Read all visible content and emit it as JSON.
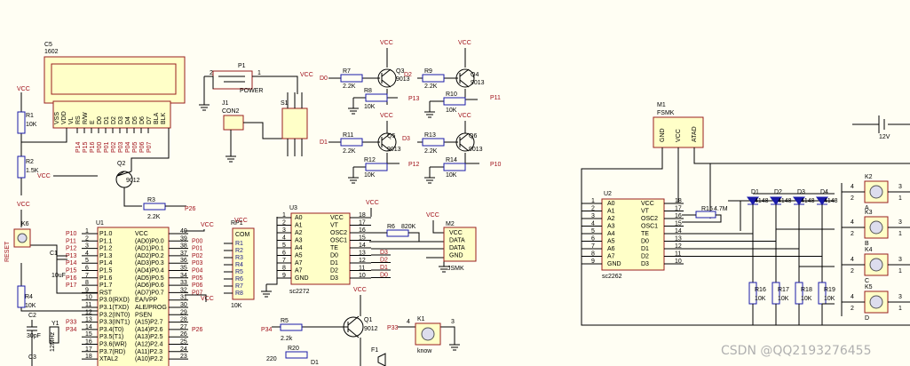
{
  "lcd": {
    "ref": "C5",
    "value": "1602",
    "pins": [
      "VSS",
      "VDD",
      "VL",
      "RS",
      "R/W",
      "E",
      "D0",
      "D1",
      "D2",
      "D3",
      "D4",
      "D5",
      "D6",
      "D7",
      "BLA",
      "BLK"
    ],
    "nets": [
      "P14",
      "P15",
      "P16",
      "P00",
      "P01",
      "P02",
      "P03",
      "P04",
      "P05",
      "P06",
      "P07"
    ]
  },
  "power_jack": {
    "ref": "P1",
    "label": "POWER",
    "pin1": "1",
    "pin2": "2"
  },
  "con2": {
    "ref": "J1",
    "label": "CON2"
  },
  "switch": {
    "ref": "S1"
  },
  "vcc": "VCC",
  "r1": {
    "ref": "R1",
    "value": "10K"
  },
  "r2": {
    "ref": "R2",
    "value": "1.5K"
  },
  "q2": {
    "ref": "Q2",
    "value": "9012"
  },
  "r3": {
    "ref": "R3",
    "value": "2.2K",
    "net": "P26"
  },
  "mcu": {
    "ref": "U1",
    "left_pins": [
      {
        "num": "1",
        "name": "P1.0",
        "net": "P10"
      },
      {
        "num": "2",
        "name": "P1.1",
        "net": "P11"
      },
      {
        "num": "3",
        "name": "P1.2",
        "net": "P12"
      },
      {
        "num": "4",
        "name": "P1.3",
        "net": "P13"
      },
      {
        "num": "5",
        "name": "P1.4",
        "net": "P14"
      },
      {
        "num": "6",
        "name": "P1.5",
        "net": "P15"
      },
      {
        "num": "7",
        "name": "P1.6",
        "net": "P16"
      },
      {
        "num": "8",
        "name": "P1.7",
        "net": "P17"
      },
      {
        "num": "9",
        "name": "RST",
        "net": ""
      },
      {
        "num": "10",
        "name": "P3.0(RXD)",
        "net": ""
      },
      {
        "num": "11",
        "name": "P3.1(TXD)",
        "net": ""
      },
      {
        "num": "12",
        "name": "P3.2(INT0)",
        "net": ""
      },
      {
        "num": "13",
        "name": "P3.3(INT1)",
        "net": "P33"
      },
      {
        "num": "14",
        "name": "P3.4(T0)",
        "net": "P34"
      },
      {
        "num": "15",
        "name": "P3.5(T1)",
        "net": ""
      },
      {
        "num": "16",
        "name": "P3.6(WR)",
        "net": ""
      },
      {
        "num": "17",
        "name": "P3.7(RD)",
        "net": ""
      },
      {
        "num": "18",
        "name": "XTAL2",
        "net": ""
      }
    ],
    "right_pins": [
      {
        "num": "40",
        "name": "VCC",
        "net": ""
      },
      {
        "num": "39",
        "name": "(AD0)P0.0",
        "net": "P00"
      },
      {
        "num": "38",
        "name": "(AD1)P0.1",
        "net": "P01"
      },
      {
        "num": "37",
        "name": "(AD2)P0.2",
        "net": "P02"
      },
      {
        "num": "36",
        "name": "(AD3)P0.3",
        "net": "P03"
      },
      {
        "num": "35",
        "name": "(AD4)P0.4",
        "net": "P04"
      },
      {
        "num": "34",
        "name": "(AD5)P0.5",
        "net": "P05"
      },
      {
        "num": "33",
        "name": "(AD6)P0.6",
        "net": "P06"
      },
      {
        "num": "32",
        "name": "(AD7)P0.7",
        "net": "P07"
      },
      {
        "num": "31",
        "name": "EA/VPP",
        "net": ""
      },
      {
        "num": "30",
        "name": "ALE/PROG",
        "net": ""
      },
      {
        "num": "29",
        "name": "PSEN",
        "net": ""
      },
      {
        "num": "28",
        "name": "(A15)P2.7",
        "net": ""
      },
      {
        "num": "27",
        "name": "(A14)P2.6",
        "net": "P26"
      },
      {
        "num": "26",
        "name": "(A13)P2.5",
        "net": ""
      },
      {
        "num": "25",
        "name": "(A12)P2.4",
        "net": ""
      },
      {
        "num": "24",
        "name": "(A11)P2.3",
        "net": ""
      },
      {
        "num": "23",
        "name": "(A10)P2.2",
        "net": ""
      }
    ]
  },
  "rp1": {
    "ref": "RP1",
    "value": "10K",
    "com": "COM",
    "pins": [
      "R1",
      "R2",
      "R3",
      "R4",
      "R5",
      "R6",
      "R7",
      "R8"
    ]
  },
  "reset": {
    "ref": "K6",
    "label": "RESET"
  },
  "c1": {
    "ref": "C1",
    "value": "10uF"
  },
  "r4": {
    "ref": "R4",
    "value": "10K"
  },
  "c2": {
    "ref": "C2",
    "value": "30pF"
  },
  "c3": {
    "ref": "C3"
  },
  "y1": {
    "ref": "Y1",
    "value": "12MHz"
  },
  "relay_top": {
    "input": "D0",
    "r7": {
      "ref": "R7",
      "value": "2.2K"
    },
    "q3": {
      "ref": "Q3",
      "value": "9013"
    },
    "d2": "D2",
    "r9": {
      "ref": "R9",
      "value": "2.2K"
    },
    "q4": {
      "ref": "Q4",
      "value": "9013"
    },
    "r8": {
      "ref": "R8",
      "value": "10K"
    },
    "p13": "P13",
    "r10": {
      "ref": "R10",
      "value": "10K"
    },
    "p11": "P11"
  },
  "relay_bot": {
    "input": "D1",
    "r11": {
      "ref": "R11",
      "value": "2.2K"
    },
    "q5": {
      "ref": "Q5",
      "value": "9013"
    },
    "d3": "D3",
    "r13": {
      "ref": "R13",
      "value": "2.2K"
    },
    "q6": {
      "ref": "Q6",
      "value": "9013"
    },
    "r12": {
      "ref": "R12",
      "value": "10K"
    },
    "p12": "P12",
    "r14": {
      "ref": "R14",
      "value": "10K"
    },
    "p10": "P10"
  },
  "encoder": {
    "ref": "U3",
    "part": "sc2272",
    "left_pins": [
      {
        "num": "1",
        "name": "A0"
      },
      {
        "num": "2",
        "name": "A1"
      },
      {
        "num": "3",
        "name": "A2"
      },
      {
        "num": "4",
        "name": "A3"
      },
      {
        "num": "5",
        "name": "A4"
      },
      {
        "num": "6",
        "name": "A5"
      },
      {
        "num": "7",
        "name": "A7"
      },
      {
        "num": "8",
        "name": "A7"
      },
      {
        "num": "9",
        "name": "GND"
      }
    ],
    "right_pins": [
      {
        "num": "18",
        "name": "VCC"
      },
      {
        "num": "17",
        "name": "VT"
      },
      {
        "num": "16",
        "name": "OSC2"
      },
      {
        "num": "15",
        "name": "OSC1"
      },
      {
        "num": "14",
        "name": "TE"
      },
      {
        "num": "13",
        "name": "D0"
      },
      {
        "num": "12",
        "name": "D1"
      },
      {
        "num": "11",
        "name": "D2"
      },
      {
        "num": "10",
        "name": "D3"
      }
    ],
    "outs": [
      "D3",
      "D2",
      "D1",
      "D0"
    ]
  },
  "r6": {
    "ref": "R6",
    "value": "820K"
  },
  "m2": {
    "ref": "M2",
    "label": "JSMK",
    "pins": [
      "VCC",
      "DATA",
      "DATA",
      "GND"
    ]
  },
  "q1": {
    "ref": "Q1",
    "value": "9012"
  },
  "r5": {
    "ref": "R5",
    "value": "2.2k",
    "net": "P34"
  },
  "r20": {
    "ref": "R20",
    "value": "220"
  },
  "d1": "D1",
  "f1": "F1",
  "k1": {
    "ref": "K1",
    "label": "know",
    "net": "P33",
    "pin3": "3",
    "pin4": "4"
  },
  "m1": {
    "ref": "M1",
    "label": "FSMK",
    "pins": [
      "GND",
      "VCC",
      "ATAD"
    ]
  },
  "battery": {
    "value": "12V"
  },
  "decoder": {
    "ref": "U2",
    "part": "sc2262",
    "left_pins": [
      {
        "num": "1",
        "name": "A0"
      },
      {
        "num": "2",
        "name": "A1"
      },
      {
        "num": "3",
        "name": "A2"
      },
      {
        "num": "4",
        "name": "A3"
      },
      {
        "num": "5",
        "name": "A4"
      },
      {
        "num": "6",
        "name": "A5"
      },
      {
        "num": "7",
        "name": "A6"
      },
      {
        "num": "8",
        "name": "A7"
      },
      {
        "num": "9",
        "name": "GND"
      }
    ],
    "right_pins": [
      {
        "num": "18",
        "name": "VCC"
      },
      {
        "num": "17",
        "name": "VT"
      },
      {
        "num": "16",
        "name": "OSC2"
      },
      {
        "num": "15",
        "name": "OSC1"
      },
      {
        "num": "14",
        "name": "TE"
      },
      {
        "num": "13",
        "name": "D0"
      },
      {
        "num": "12",
        "name": "D1"
      },
      {
        "num": "11",
        "name": "D2"
      },
      {
        "num": "10",
        "name": "D3"
      }
    ]
  },
  "r15": {
    "ref": "R15",
    "value": "4.7M"
  },
  "diodes": [
    {
      "ref": "D1",
      "value": "4148"
    },
    {
      "ref": "D2",
      "value": "4148"
    },
    {
      "ref": "D3",
      "value": "4148"
    },
    {
      "ref": "D4",
      "value": "4148"
    }
  ],
  "pulldowns": [
    {
      "ref": "R16",
      "value": "10K"
    },
    {
      "ref": "R17",
      "value": "10K"
    },
    {
      "ref": "R18",
      "value": "10K"
    },
    {
      "ref": "R19",
      "value": "10K"
    }
  ],
  "keys": [
    {
      "ref": "K2",
      "label": "A"
    },
    {
      "ref": "K3",
      "label": "B"
    },
    {
      "ref": "K4",
      "label": "C"
    },
    {
      "ref": "K5",
      "label": "D"
    }
  ],
  "key_pin_left": "4",
  "key_pin_right": "3",
  "key_pin_ll": "2",
  "key_pin_rr": "1",
  "watermark": "CSDN @QQ2193276455"
}
